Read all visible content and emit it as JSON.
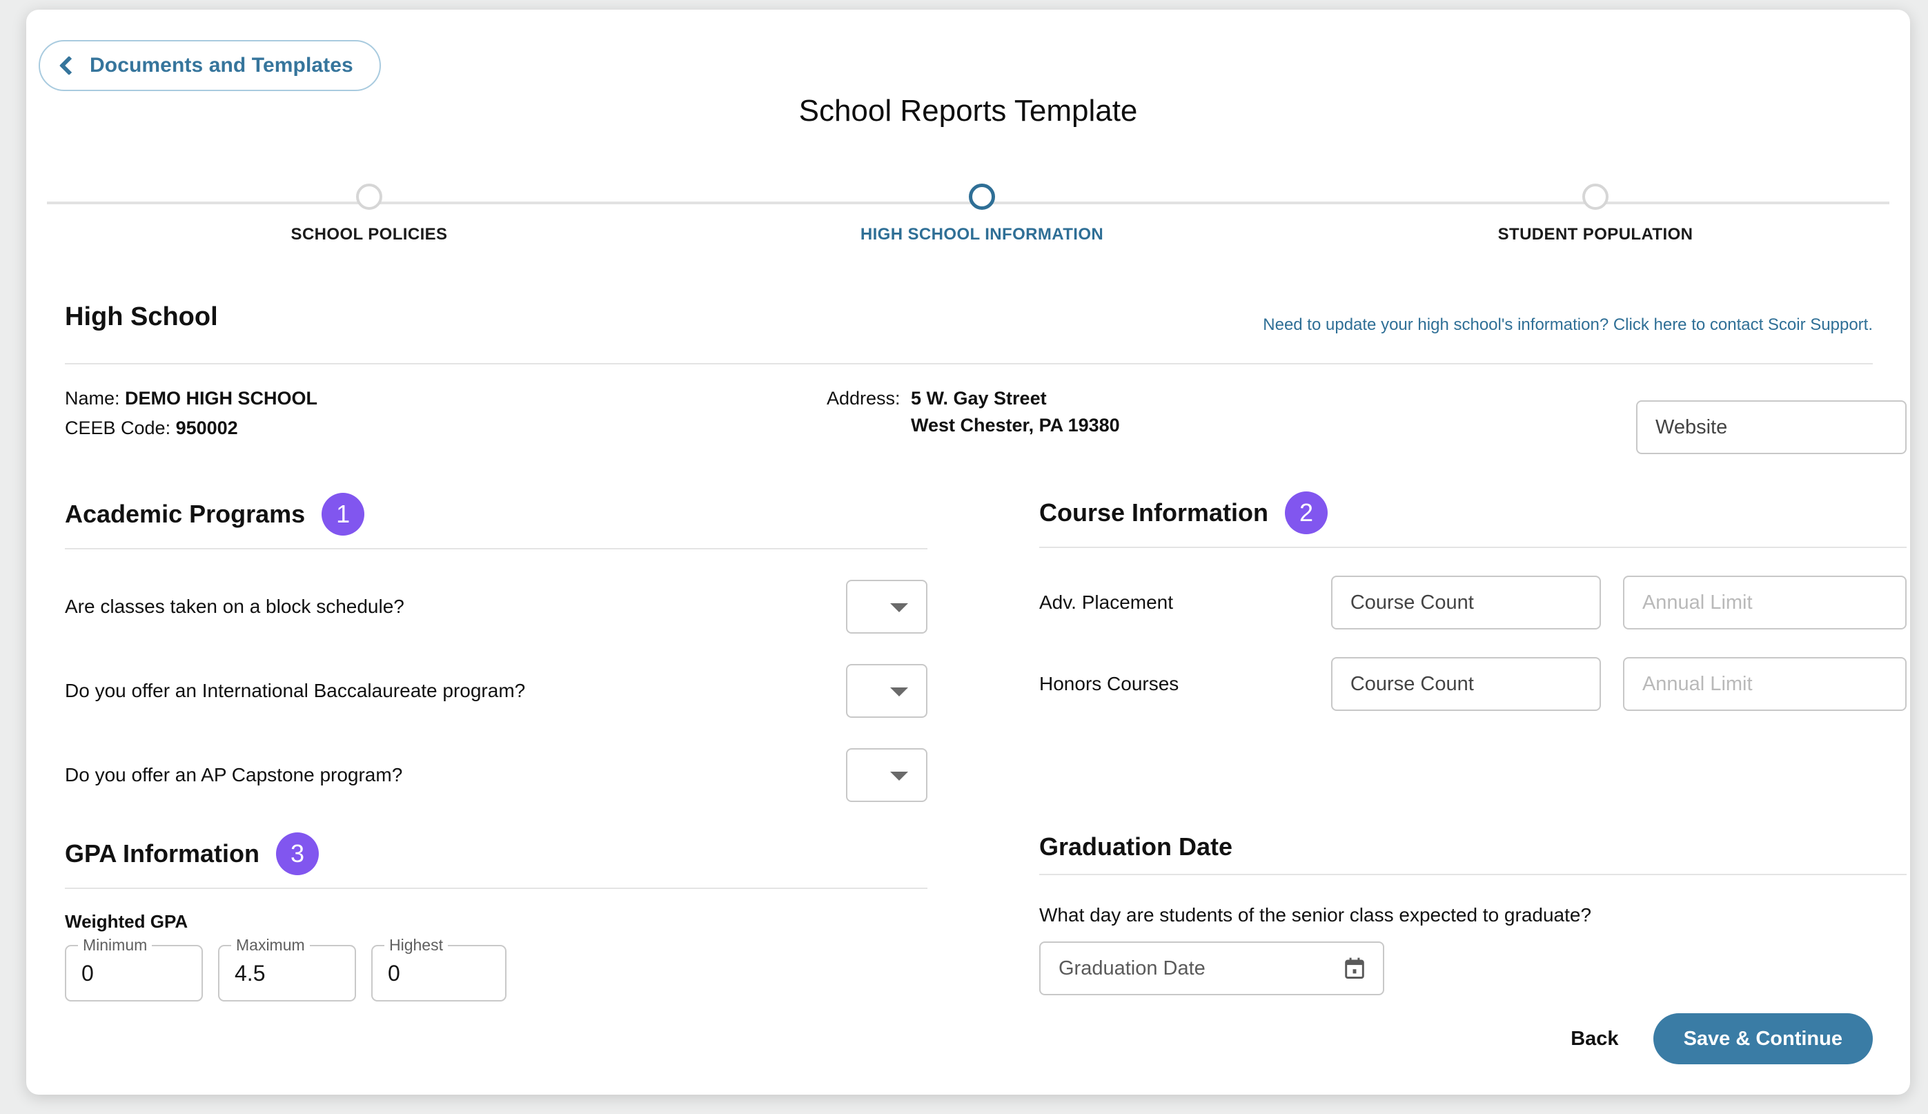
{
  "header": {
    "back_label": "Documents and Templates",
    "title": "School Reports Template"
  },
  "stepper": {
    "steps": [
      {
        "label": "SCHOOL POLICIES",
        "active": false
      },
      {
        "label": "HIGH SCHOOL INFORMATION",
        "active": true
      },
      {
        "label": "STUDENT POPULATION",
        "active": false
      }
    ]
  },
  "high_school": {
    "heading": "High School",
    "support_link": "Need to update your high school's information? Click here to contact Scoir Support.",
    "name_label": "Name:",
    "name_value": "DEMO HIGH SCHOOL",
    "ceeb_label": "CEEB Code:",
    "ceeb_value": "950002",
    "address_label": "Address:",
    "address_line1": "5 W. Gay Street",
    "address_line2": "West Chester, PA 19380",
    "website_value": "Website"
  },
  "academic_programs": {
    "title": "Academic Programs",
    "badge": "1",
    "questions": [
      {
        "text": "Are classes taken on a block schedule?",
        "value": ""
      },
      {
        "text": "Do you offer an International Baccalaureate program?",
        "value": ""
      },
      {
        "text": "Do you offer an AP Capstone program?",
        "value": ""
      }
    ]
  },
  "course_information": {
    "title": "Course Information",
    "badge": "2",
    "rows": [
      {
        "label": "Adv. Placement",
        "course_count": "Course Count",
        "annual_limit": "Annual Limit"
      },
      {
        "label": "Honors Courses",
        "course_count": "Course Count",
        "annual_limit": "Annual Limit"
      }
    ]
  },
  "gpa_information": {
    "title": "GPA Information",
    "badge": "3",
    "subheading": "Weighted GPA",
    "fields": [
      {
        "label": "Minimum",
        "value": "0"
      },
      {
        "label": "Maximum",
        "value": "4.5"
      },
      {
        "label": "Highest",
        "value": "0"
      }
    ]
  },
  "graduation_date": {
    "title": "Graduation Date",
    "question": "What day are students of the senior class expected to graduate?",
    "placeholder": "Graduation Date"
  },
  "footer": {
    "back_label": "Back",
    "save_label": "Save & Continue"
  },
  "colors": {
    "accent_blue": "#3a7ca5",
    "step_active": "#2f6f96",
    "badge_purple": "#8156ef",
    "link_blue": "#2f6f96"
  }
}
